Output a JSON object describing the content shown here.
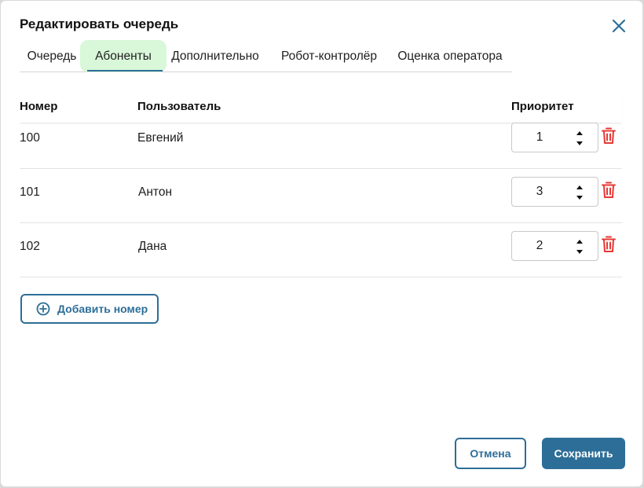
{
  "dialog": {
    "title": "Редактировать очередь",
    "close_icon": "close-icon"
  },
  "tabs": [
    {
      "label": "Очередь",
      "active": false
    },
    {
      "label": "Абоненты",
      "active": true
    },
    {
      "label": "Дополнительно",
      "active": false
    },
    {
      "label": "Робот-контролёр",
      "active": false
    },
    {
      "label": "Оценка оператора",
      "active": false
    }
  ],
  "table": {
    "columns": [
      "Номер",
      "Пользователь",
      "Приоритет"
    ],
    "rows": [
      {
        "number": "100",
        "user": "Евгений",
        "priority": "1"
      },
      {
        "number": "101",
        "user": "Антон",
        "priority": "3"
      },
      {
        "number": "102",
        "user": "Дана",
        "priority": "2"
      }
    ]
  },
  "actions": {
    "add_number": "Добавить номер",
    "cancel": "Отмена",
    "save": "Сохранить"
  },
  "icons": {
    "add": "plus-circle-icon",
    "delete": "trash-icon",
    "spin_up": "caret-up-icon",
    "spin_down": "caret-down-icon"
  },
  "colors": {
    "accent": "#2d6e98",
    "active_tab_bg": "#d9f7d9",
    "delete": "#e53935"
  }
}
